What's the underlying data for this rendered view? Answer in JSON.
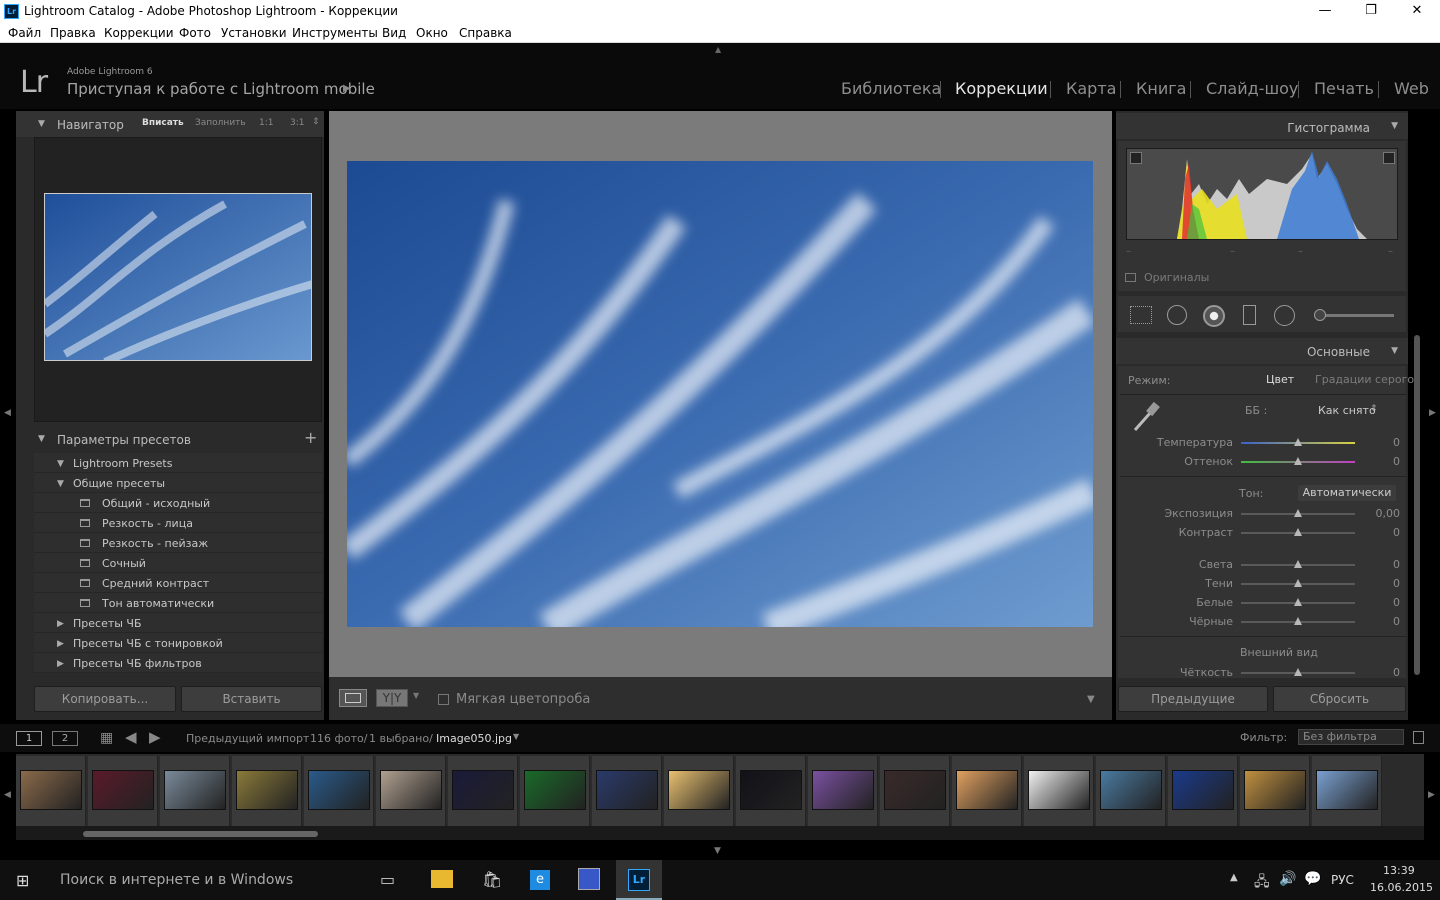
{
  "window": {
    "title": "Lightroom Catalog - Adobe Photoshop Lightroom - Коррекции",
    "app_icon": "Lr"
  },
  "menu": [
    "Файл",
    "Правка",
    "Коррекции",
    "Фото",
    "Установки",
    "Инструменты",
    "Вид",
    "Окно",
    "Справка"
  ],
  "identity": {
    "small": "Adobe Lightroom 6",
    "main": "Приступая к работе с Lightroom mobile",
    "logo": "Lr"
  },
  "modules": [
    "Библиотека",
    "Коррекции",
    "Карта",
    "Книга",
    "Слайд-шоу",
    "Печать",
    "Web"
  ],
  "active_module": "Коррекции",
  "navigator": {
    "title": "Навигатор",
    "options": [
      "Вписать",
      "Заполнить",
      "1:1",
      "3:1"
    ]
  },
  "presets": {
    "title": "Параметры пресетов",
    "rows": [
      {
        "label": "Lightroom Presets",
        "level": 0,
        "open": true
      },
      {
        "label": "Общие пресеты",
        "level": 0,
        "open": true
      },
      {
        "label": "Общий - исходный",
        "level": 1
      },
      {
        "label": "Резкость - лица",
        "level": 1
      },
      {
        "label": "Резкость - пейзаж",
        "level": 1
      },
      {
        "label": "Сочный",
        "level": 1
      },
      {
        "label": "Средний контраст",
        "level": 1
      },
      {
        "label": "Тон автоматически",
        "level": 1
      },
      {
        "label": "Пресеты ЧБ",
        "level": 0,
        "open": false
      },
      {
        "label": "Пресеты ЧБ с тонировкой",
        "level": 0,
        "open": false
      },
      {
        "label": "Пресеты ЧБ фильтров",
        "level": 0,
        "open": false
      }
    ]
  },
  "left_buttons": {
    "copy": "Копировать...",
    "paste": "Вставить"
  },
  "toolbar": {
    "softproof": "Мягкая цветопроба",
    "compare": "Y|Y"
  },
  "histogram": {
    "title": "Гистограмма",
    "originals": "Оригиналы",
    "ticks": [
      "–",
      "–",
      "–",
      "–"
    ]
  },
  "basic": {
    "title": "Основные",
    "mode_label": "Режим:",
    "mode_color": "Цвет",
    "mode_gray": "Градации серого",
    "wb_label": "ББ :",
    "wb_value": "Как снято",
    "tone_label": "Тон:",
    "tone_auto": "Автоматически",
    "presence": "Внешний вид",
    "sliders": [
      {
        "label": "Температура",
        "value": "0",
        "pos": 0.5
      },
      {
        "label": "Оттенок",
        "value": "0",
        "pos": 0.5
      },
      {
        "label": "Экспозиция",
        "value": "0,00",
        "pos": 0.5
      },
      {
        "label": "Контраст",
        "value": "0",
        "pos": 0.5
      },
      {
        "label": "Света",
        "value": "0",
        "pos": 0.5
      },
      {
        "label": "Тени",
        "value": "0",
        "pos": 0.5
      },
      {
        "label": "Белые",
        "value": "0",
        "pos": 0.5
      },
      {
        "label": "Чёрные",
        "value": "0",
        "pos": 0.5
      },
      {
        "label": "Чёткость",
        "value": "0",
        "pos": 0.5
      }
    ]
  },
  "right_buttons": {
    "previous": "Предыдущие",
    "reset": "Сбросить"
  },
  "filmbar": {
    "screen1": "1",
    "screen2": "2",
    "source": "Предыдущий импорт",
    "count": "116 фото/",
    "selected": "1 выбрано/",
    "file": "Image050.jpg",
    "filter_label": "Фильтр:",
    "filter_value": "Без фильтра"
  },
  "taskbar": {
    "search": "Поиск в интернете и в Windows",
    "lang": "РУС",
    "time": "13:39",
    "date": "16.06.2015"
  },
  "colors": {
    "accent": "#31a8ff",
    "panel": "#2a2a2a",
    "sky": "#3a6ab0"
  }
}
